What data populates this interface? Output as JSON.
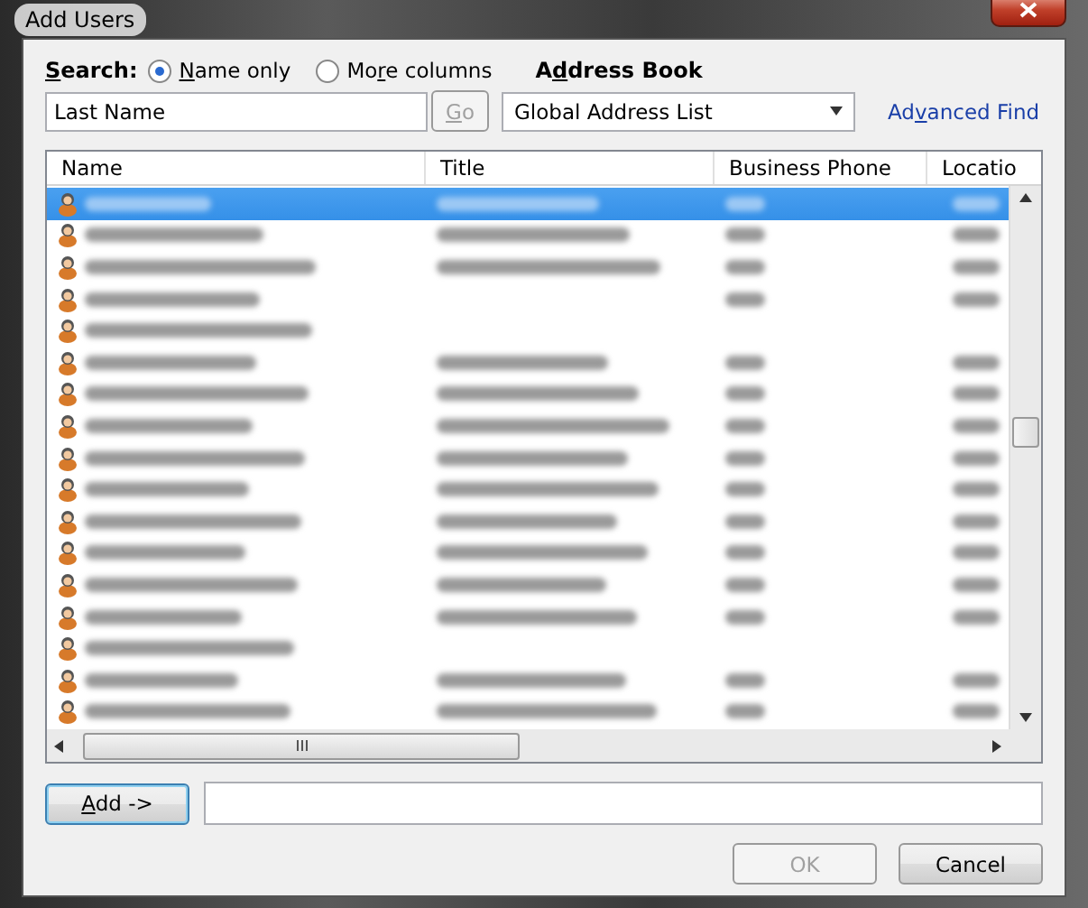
{
  "window": {
    "title": "Add Users"
  },
  "search": {
    "label": [
      {
        "text": "S",
        "underline": true
      },
      {
        "text": "earch:",
        "underline": false
      }
    ],
    "options": [
      {
        "label": [
          {
            "text": "N",
            "underline": true
          },
          {
            "text": "ame only",
            "underline": false
          }
        ],
        "selected": true
      },
      {
        "label": [
          {
            "text": "Mo",
            "underline": false
          },
          {
            "text": "r",
            "underline": true
          },
          {
            "text": "e columns",
            "underline": false
          }
        ],
        "selected": false
      }
    ],
    "field": {
      "placeholder": "Last Name"
    },
    "go_button": {
      "label": [
        {
          "text": "G",
          "underline": true
        },
        {
          "text": "o",
          "underline": false
        }
      ],
      "disabled": true
    }
  },
  "address_book": {
    "label": [
      {
        "text": "A",
        "underline": false
      },
      {
        "text": "d",
        "underline": true
      },
      {
        "text": "dress Book",
        "underline": false
      }
    ],
    "value": "Global Address List",
    "advanced_find": {
      "label": [
        {
          "text": "Ad",
          "underline": false
        },
        {
          "text": "v",
          "underline": true
        },
        {
          "text": "anced Find",
          "underline": false
        }
      ]
    }
  },
  "table": {
    "columns": [
      "Name",
      "Title",
      "Business Phone",
      "Locatio"
    ],
    "rows": [
      {
        "selected": true,
        "cells": [
          true,
          true,
          true,
          true
        ]
      },
      {
        "selected": false,
        "cells": [
          true,
          true,
          true,
          true
        ]
      },
      {
        "selected": false,
        "cells": [
          true,
          true,
          true,
          true
        ]
      },
      {
        "selected": false,
        "cells": [
          true,
          false,
          true,
          true
        ]
      },
      {
        "selected": false,
        "cells": [
          true,
          false,
          false,
          false
        ]
      },
      {
        "selected": false,
        "cells": [
          true,
          true,
          true,
          true
        ]
      },
      {
        "selected": false,
        "cells": [
          true,
          true,
          true,
          true
        ]
      },
      {
        "selected": false,
        "cells": [
          true,
          true,
          true,
          true
        ]
      },
      {
        "selected": false,
        "cells": [
          true,
          true,
          true,
          true
        ]
      },
      {
        "selected": false,
        "cells": [
          true,
          true,
          true,
          true
        ]
      },
      {
        "selected": false,
        "cells": [
          true,
          true,
          true,
          true
        ]
      },
      {
        "selected": false,
        "cells": [
          true,
          true,
          true,
          true
        ]
      },
      {
        "selected": false,
        "cells": [
          true,
          true,
          true,
          true
        ]
      },
      {
        "selected": false,
        "cells": [
          true,
          true,
          true,
          true
        ]
      },
      {
        "selected": false,
        "cells": [
          true,
          false,
          false,
          false
        ]
      },
      {
        "selected": false,
        "cells": [
          true,
          true,
          true,
          true
        ]
      },
      {
        "selected": false,
        "cells": [
          true,
          true,
          true,
          true
        ]
      }
    ]
  },
  "add_button": {
    "label": [
      {
        "text": "A",
        "underline": true
      },
      {
        "text": "dd ->",
        "underline": false
      }
    ]
  },
  "buttons": [
    {
      "label": "OK",
      "disabled": true
    },
    {
      "label": "Cancel",
      "disabled": false
    }
  ]
}
